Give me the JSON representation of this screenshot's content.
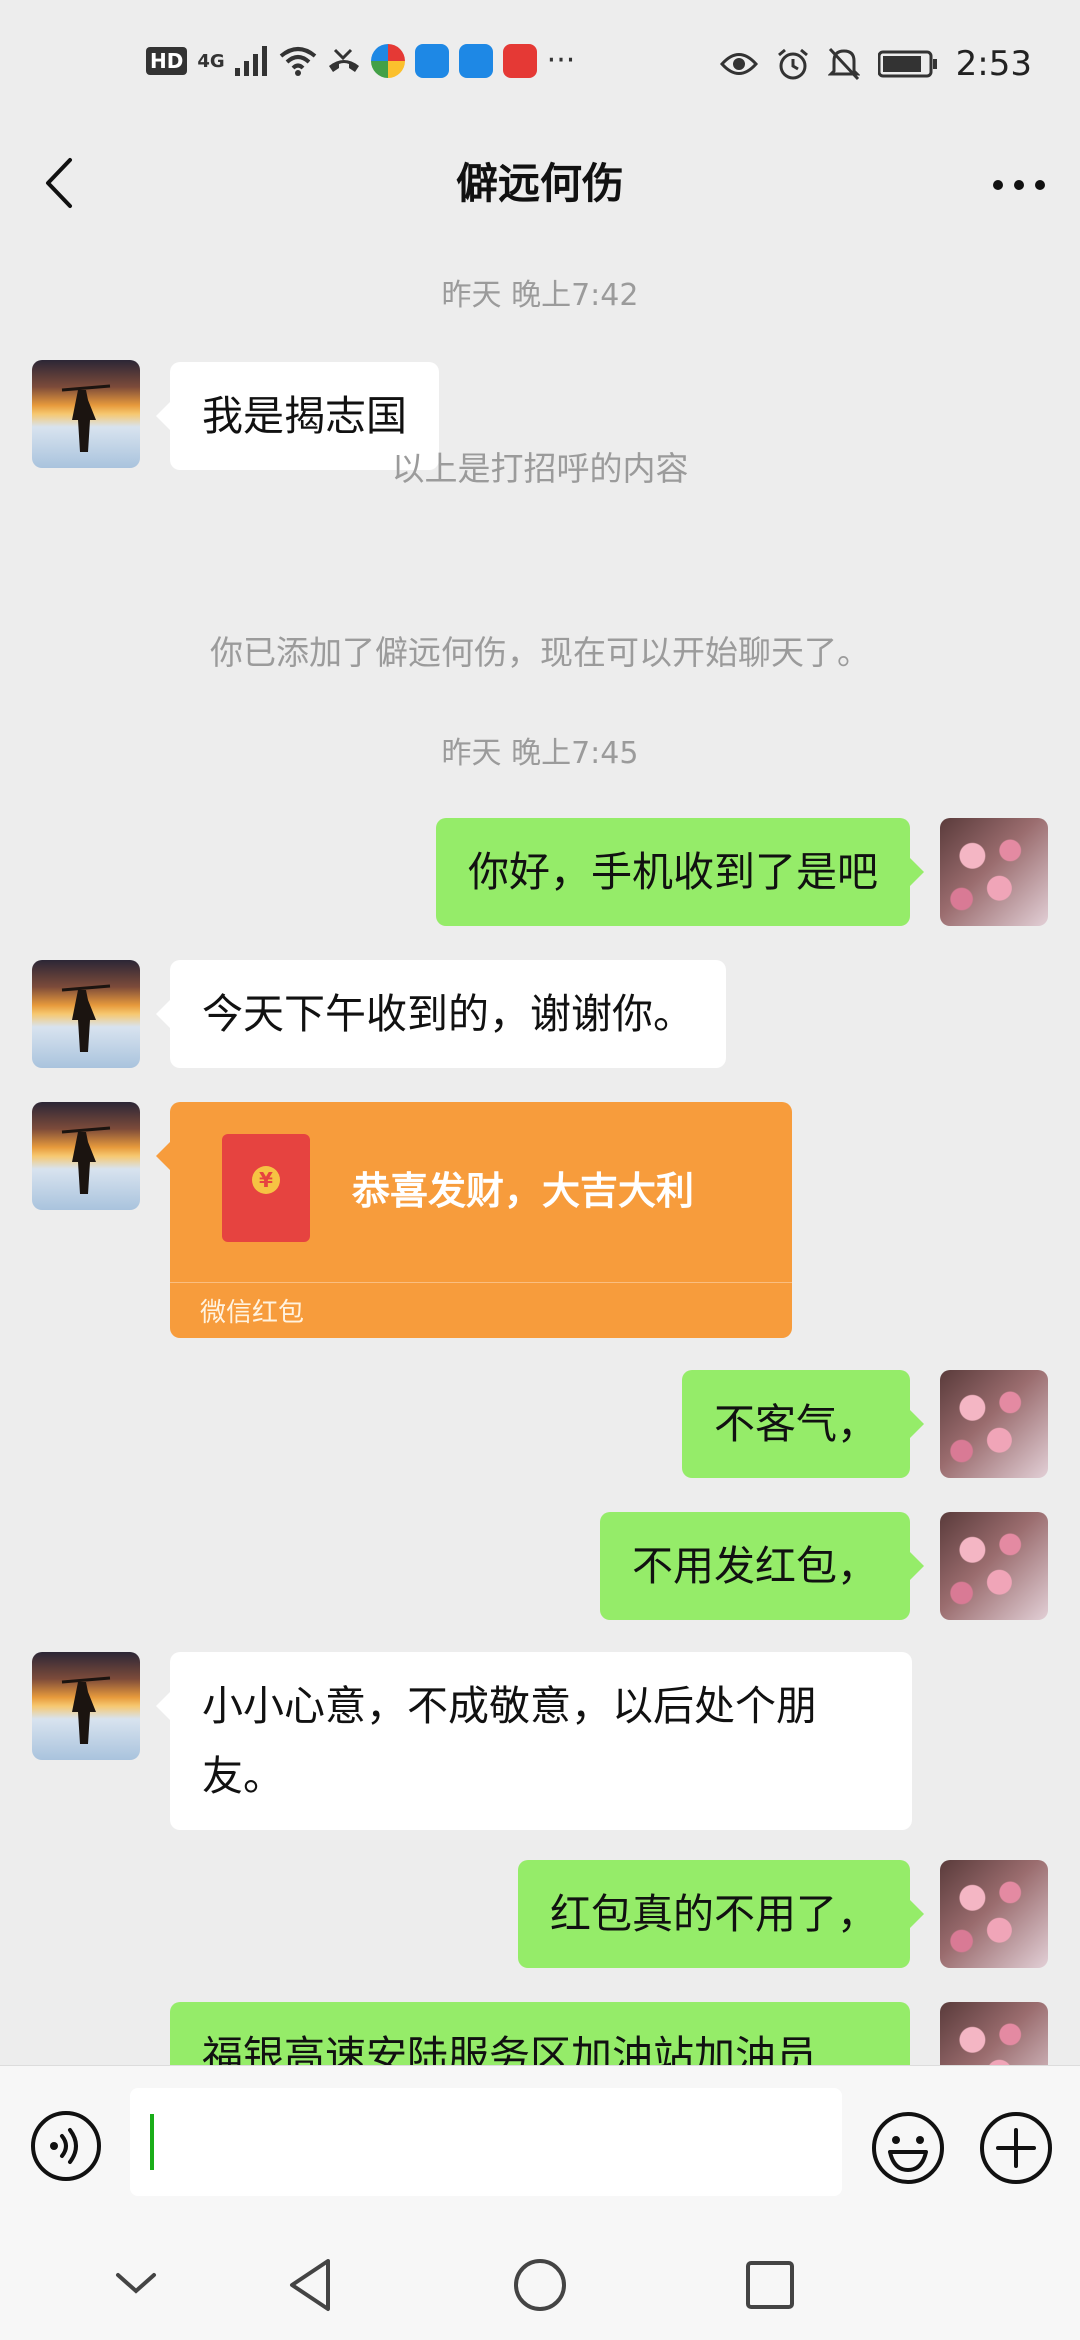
{
  "status_bar": {
    "hd": "HD",
    "network": "4G",
    "more": "···",
    "time": "2:53"
  },
  "nav": {
    "title": "僻远何伤"
  },
  "messages": {
    "ts1": "昨天 晚上7:42",
    "m1": "我是揭志国",
    "note1": "以上是打招呼的内容",
    "note2": "你已添加了僻远何伤，现在可以开始聊天了。",
    "ts2": "昨天 晚上7:45",
    "m2": "你好，手机收到了是吧",
    "m3": "今天下午收到的，谢谢你。",
    "red_packet": {
      "title": "恭喜发财，大吉大利",
      "label": "微信红包",
      "coin": "¥"
    },
    "m4": "不客气，",
    "m5": "不用发红包，",
    "m6_line1": "小小心意，不成敬意，以后处个朋",
    "m6_line2": "友。",
    "m7": "红包真的不用了，",
    "m8_partial": "福银高速安陆服务区加油站加油员"
  },
  "colors": {
    "outgoing_bubble": "#95ec69",
    "incoming_bubble": "#ffffff",
    "red_packet": "#f79c3c",
    "background": "#ededed"
  },
  "icons": [
    "back-icon",
    "more-icon",
    "voice-icon",
    "emoji-icon",
    "plus-icon",
    "nav-back-icon",
    "nav-home-icon",
    "nav-recents-icon",
    "nav-collapse-icon"
  ]
}
